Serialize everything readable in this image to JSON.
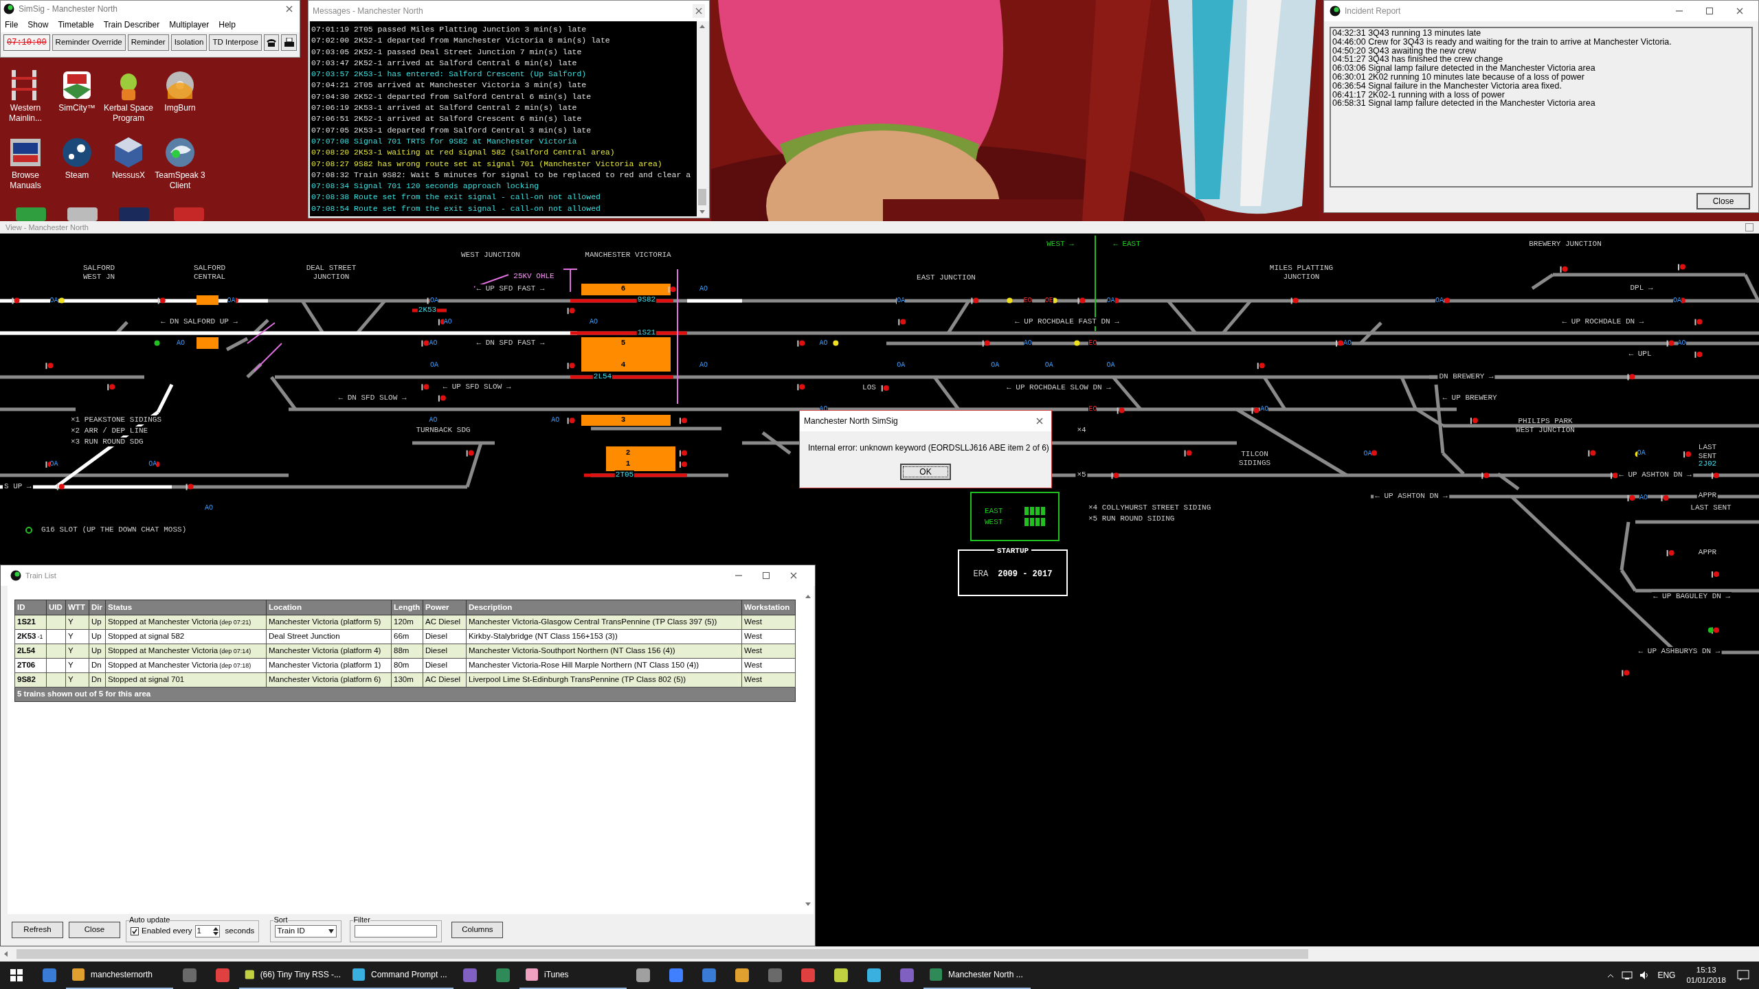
{
  "main_window": {
    "title": "SimSig - Manchester North",
    "menu": [
      "File",
      "Show",
      "Timetable",
      "Train Describer",
      "Multiplayer",
      "Help"
    ],
    "clock": "07:10:00",
    "buttons": [
      "Reminder Override",
      "Reminder",
      "Isolation",
      "TD Interpose"
    ]
  },
  "desktop_icons": [
    {
      "label": "Western Mainlin..."
    },
    {
      "label": "SimCity™"
    },
    {
      "label": "Kerbal Space Program"
    },
    {
      "label": "ImgBurn"
    },
    {
      "label": "Browse Manuals"
    },
    {
      "label": "Steam"
    },
    {
      "label": "NessusX"
    },
    {
      "label": "TeamSpeak 3 Client"
    }
  ],
  "messages_window": {
    "title": "Messages - Manchester North",
    "lines": [
      {
        "text": "07:01:19 2T05 passed Miles Platting Junction 3 min(s) late",
        "color": "#e0e0e0"
      },
      {
        "text": "07:02:00 2K52-1 departed from Manchester Victoria 8 min(s) late",
        "color": "#e0e0e0"
      },
      {
        "text": "07:03:05 2K52-1 passed Deal Street Junction 7 min(s) late",
        "color": "#e0e0e0"
      },
      {
        "text": "07:03:47 2K52-1 arrived at Salford Central 6 min(s) late",
        "color": "#e0e0e0"
      },
      {
        "text": "07:03:57 2K53-1 has entered: Salford Crescent (Up Salford)",
        "color": "#3ae0e0"
      },
      {
        "text": "07:04:21 2T05 arrived at Manchester Victoria 3 min(s) late",
        "color": "#e0e0e0"
      },
      {
        "text": "07:04:30 2K52-1 departed from Salford Central 6 min(s) late",
        "color": "#e0e0e0"
      },
      {
        "text": "07:06:19 2K53-1 arrived at Salford Central 2 min(s) late",
        "color": "#e0e0e0"
      },
      {
        "text": "07:06:51 2K52-1 arrived at Salford Crescent 6 min(s) late",
        "color": "#e0e0e0"
      },
      {
        "text": "07:07:05 2K53-1 departed from Salford Central 3 min(s) late",
        "color": "#e0e0e0"
      },
      {
        "text": "07:07:08 Signal 701 TRTS for 9S82 at Manchester Victoria",
        "color": "#3ae0e0"
      },
      {
        "text": "07:08:20 2K53-1 waiting at red signal 582 (Salford Central area)",
        "color": "#e8e83a"
      },
      {
        "text": "07:08:27 9S82 has wrong route set at signal 701 (Manchester Victoria area)",
        "color": "#e8e83a"
      },
      {
        "text": "07:08:32 Train 9S82: Wait 5 minutes for signal to be replaced to red and clear a",
        "color": "#e0e0e0"
      },
      {
        "text": "07:08:34 Signal 701 120 seconds approach locking",
        "color": "#3ae0e0"
      },
      {
        "text": "07:08:38 Route set from the exit signal - call-on not allowed",
        "color": "#3ae0e0"
      },
      {
        "text": "07:08:54 Route set from the exit signal - call-on not allowed",
        "color": "#3ae0e0"
      }
    ]
  },
  "incident_report": {
    "title": "Incident Report",
    "lines": [
      "04:32:31 3Q43 running 13 minutes late",
      "04:46:00 Crew for 3Q43 is ready and waiting for the train to arrive at Manchester Victoria.",
      "04:50:20 3Q43 awaiting the new crew",
      "04:51:27 3Q43 has finished the crew change",
      "06:03:06 Signal lamp failure detected in the Manchester Victoria area",
      "06:30:01 2K02 running 10 minutes late because of a loss of power",
      "06:36:54 Signal failure in the Manchester Victoria area fixed.",
      "06:41:17 2K02-1 running with a loss of power",
      "06:58:31 Signal lamp failure detected in the Manchester Victoria area"
    ],
    "button": "Close"
  },
  "view_window": {
    "title": "View - Manchester North",
    "labels": [
      {
        "text": "SALFORD WEST JN",
        "kind": "location"
      },
      {
        "text": "SALFORD CENTRAL",
        "kind": "location"
      },
      {
        "text": "DEAL STREET JUNCTION",
        "kind": "location"
      },
      {
        "text": "WEST JUNCTION",
        "kind": "location"
      },
      {
        "text": "MANCHESTER VICTORIA",
        "kind": "location"
      },
      {
        "text": "25KV OHLE",
        "kind": "ohle"
      },
      {
        "text": "EAST JUNCTION",
        "kind": "location"
      },
      {
        "text": "MILES PLATTING JUNCTION",
        "kind": "location"
      },
      {
        "text": "WEST →",
        "kind": "green"
      },
      {
        "text": "← EAST",
        "kind": "green"
      },
      {
        "text": "BREWERY JUNCTION",
        "kind": "location"
      },
      {
        "text": "← DN SALFORD UP →",
        "kind": "line"
      },
      {
        "text": "← UP SFD FAST →",
        "kind": "line"
      },
      {
        "text": "← DN SFD FAST →",
        "kind": "line"
      },
      {
        "text": "← UP SFD SLOW →",
        "kind": "line"
      },
      {
        "text": "← DN SFD SLOW →",
        "kind": "line"
      },
      {
        "text": "TURNBACK SDG",
        "kind": "line"
      },
      {
        "text": "×1 PEAKSTONE SIDINGS",
        "kind": "line"
      },
      {
        "text": "×2 ARR / DEP LINE",
        "kind": "line"
      },
      {
        "text": "×3 RUN ROUND SDG",
        "kind": "line"
      },
      {
        "text": "S UP →",
        "kind": "line"
      },
      {
        "text": "G16 SLOT (UP THE DOWN CHAT MOSS)",
        "kind": "line"
      },
      {
        "text": "← UP ROCHDALE FAST DN →",
        "kind": "line"
      },
      {
        "text": "LOS",
        "kind": "line"
      },
      {
        "text": "← UP ROCHDALE SLOW DN →",
        "kind": "line"
      },
      {
        "text": "TILCON SIDINGS",
        "kind": "line"
      },
      {
        "text": "×4 COLLYHURST STREET SIDING",
        "kind": "line"
      },
      {
        "text": "×5 RUN ROUND SIDING",
        "kind": "line"
      },
      {
        "text": "×4",
        "kind": "line"
      },
      {
        "text": "×5",
        "kind": "line"
      },
      {
        "text": "DPL →",
        "kind": "line"
      },
      {
        "text": "← UP ROCHDALE DN →",
        "kind": "line"
      },
      {
        "text": "← UPL",
        "kind": "line"
      },
      {
        "text": "DN BREWERY →",
        "kind": "line"
      },
      {
        "text": "← UP BREWERY",
        "kind": "line"
      },
      {
        "text": "PHILIPS PARK WEST JUNCTION",
        "kind": "location"
      },
      {
        "text": "← UP ASHTON DN →",
        "kind": "line"
      },
      {
        "text": "← UP ASHTON DN →",
        "kind": "line"
      },
      {
        "text": "LAST SENT",
        "kind": "line"
      },
      {
        "text": "2J02",
        "kind": "berth"
      },
      {
        "text": "APPR",
        "kind": "line"
      },
      {
        "text": "LAST SENT",
        "kind": "line"
      },
      {
        "text": "APPR",
        "kind": "line"
      },
      {
        "text": "← UP BAGULEY DN →",
        "kind": "line"
      },
      {
        "text": "← UP ASHBURYS DN →",
        "kind": "line"
      },
      {
        "text": "6",
        "kind": "platform"
      },
      {
        "text": "9S82",
        "kind": "berth"
      },
      {
        "text": "2K53",
        "kind": "berth"
      },
      {
        "text": "1S21",
        "kind": "berth"
      },
      {
        "text": "5",
        "kind": "platform"
      },
      {
        "text": "4",
        "kind": "platform"
      },
      {
        "text": "2L54",
        "kind": "berth"
      },
      {
        "text": "3",
        "kind": "platform"
      },
      {
        "text": "2",
        "kind": "platform"
      },
      {
        "text": "1",
        "kind": "platform"
      },
      {
        "text": "2T05",
        "kind": "berth"
      }
    ],
    "signal_plates": [
      {
        "text": "OA",
        "kind": "ao"
      },
      {
        "text": "OA",
        "kind": "ao"
      },
      {
        "text": "OA",
        "kind": "ao"
      },
      {
        "text": "AO",
        "kind": "ao"
      },
      {
        "text": "AO",
        "kind": "ao"
      },
      {
        "text": "AO",
        "kind": "ao"
      },
      {
        "text": "OA",
        "kind": "ao"
      },
      {
        "text": "OA",
        "kind": "ao"
      },
      {
        "text": "OA",
        "kind": "ao"
      },
      {
        "text": "OA",
        "kind": "ao"
      },
      {
        "text": "AO",
        "kind": "ao"
      },
      {
        "text": "AO",
        "kind": "ao"
      },
      {
        "text": "AO",
        "kind": "ao"
      },
      {
        "text": "AO",
        "kind": "ao"
      },
      {
        "text": "AO",
        "kind": "ao"
      },
      {
        "text": "AO",
        "kind": "ao"
      },
      {
        "text": "OA",
        "kind": "ao"
      },
      {
        "text": "AO",
        "kind": "ao"
      },
      {
        "text": "OA",
        "kind": "ao"
      },
      {
        "text": "OA",
        "kind": "ao"
      },
      {
        "text": "OA",
        "kind": "ao"
      },
      {
        "text": "OA",
        "kind": "ao"
      },
      {
        "text": "AO",
        "kind": "ao"
      },
      {
        "text": "AO",
        "kind": "ao"
      },
      {
        "text": "AO",
        "kind": "ao"
      },
      {
        "text": "AO",
        "kind": "ao"
      },
      {
        "text": "OA",
        "kind": "ao"
      },
      {
        "text": "OA",
        "kind": "ao"
      },
      {
        "text": "AO",
        "kind": "ao"
      },
      {
        "text": "OA",
        "kind": "ao"
      },
      {
        "text": "OA",
        "kind": "ao"
      },
      {
        "text": "AO",
        "kind": "ao"
      },
      {
        "text": "EO",
        "kind": "eo"
      },
      {
        "text": "OE",
        "kind": "eo"
      },
      {
        "text": "EO",
        "kind": "eo"
      },
      {
        "text": "EO",
        "kind": "eo"
      }
    ],
    "direction_panel": {
      "labels": [
        "EAST",
        "WEST"
      ]
    },
    "startup_panel": {
      "title": "STARTUP",
      "era_label": "ERA",
      "era": "2009 - 2017"
    }
  },
  "dialog": {
    "title": "Manchester North SimSig",
    "message": "Internal error: unknown keyword (EORDSLLJ616 ABE item 2 of 6)",
    "button": "OK"
  },
  "train_list": {
    "title": "Train List",
    "columns": [
      "ID",
      "UID",
      "WTT",
      "Dir",
      "Status",
      "Location",
      "Length",
      "Power",
      "Description",
      "Workstation"
    ],
    "rows": [
      {
        "id": "1S21",
        "wtt": "Y",
        "dir": "Up",
        "status": "Stopped at Manchester Victoria",
        "status_note": "(dep 07:21)",
        "location": "Manchester Victoria (platform 5)",
        "length": "120m",
        "power": "AC Diesel",
        "description": "Manchester Victoria-Glasgow Central TransPennine (TP Class 397 (5))",
        "workstation": "West"
      },
      {
        "id": "2K53",
        "id_suffix": "-1",
        "wtt": "Y",
        "dir": "Up",
        "status": "Stopped at signal 582",
        "location": "Deal Street Junction",
        "length": "66m",
        "power": "Diesel",
        "description": "Kirkby-Stalybridge (NT Class 156+153 (3))",
        "workstation": "West"
      },
      {
        "id": "2L54",
        "wtt": "Y",
        "dir": "Up",
        "status": "Stopped at Manchester Victoria",
        "status_note": "(dep 07:14)",
        "location": "Manchester Victoria (platform 4)",
        "length": "88m",
        "power": "Diesel",
        "description": "Manchester Victoria-Southport Northern (NT Class 156 (4))",
        "workstation": "West"
      },
      {
        "id": "2T06",
        "wtt": "Y",
        "dir": "Dn",
        "status": "Stopped at Manchester Victoria",
        "status_note": "(dep 07:18)",
        "location": "Manchester Victoria (platform 1)",
        "length": "80m",
        "power": "Diesel",
        "description": "Manchester Victoria-Rose Hill Marple Northern (NT Class 150 (4))",
        "workstation": "West"
      },
      {
        "id": "9S82",
        "wtt": "Y",
        "dir": "Dn",
        "status": "Stopped at signal 701",
        "location": "Manchester Victoria (platform 6)",
        "length": "130m",
        "power": "AC Diesel",
        "description": "Liverpool Lime St-Edinburgh TransPennine (TP Class 802 (5))",
        "workstation": "West"
      }
    ],
    "summary": "5 trains shown out of 5 for this area",
    "buttons": [
      "Refresh",
      "Close"
    ],
    "auto_update": {
      "label": "Auto update",
      "checkbox_label": "Enabled every",
      "checked": true,
      "interval": "1",
      "unit": "seconds"
    },
    "sort": {
      "label": "Sort",
      "value": "Train ID"
    },
    "filter": {
      "label": "Filter"
    },
    "columns_button": "Columns"
  },
  "taskbar": {
    "items": [
      {
        "kind": "start"
      },
      {
        "kind": "icon"
      },
      {
        "kind": "app",
        "label": "manchesternorth"
      },
      {
        "kind": "icon"
      },
      {
        "kind": "icon"
      },
      {
        "kind": "app",
        "label": "(66) Tiny Tiny RSS -..."
      },
      {
        "kind": "app",
        "label": "Command Prompt ..."
      },
      {
        "kind": "icon"
      },
      {
        "kind": "icon"
      },
      {
        "kind": "app",
        "label": "iTunes"
      },
      {
        "kind": "icon"
      },
      {
        "kind": "icon"
      },
      {
        "kind": "icon"
      },
      {
        "kind": "icon"
      },
      {
        "kind": "icon"
      },
      {
        "kind": "icon"
      },
      {
        "kind": "icon"
      },
      {
        "kind": "icon"
      },
      {
        "kind": "icon"
      },
      {
        "kind": "app",
        "label": "Manchester North ..."
      }
    ],
    "language": "ENG",
    "time": "15:13",
    "date": "01/01/2018"
  }
}
